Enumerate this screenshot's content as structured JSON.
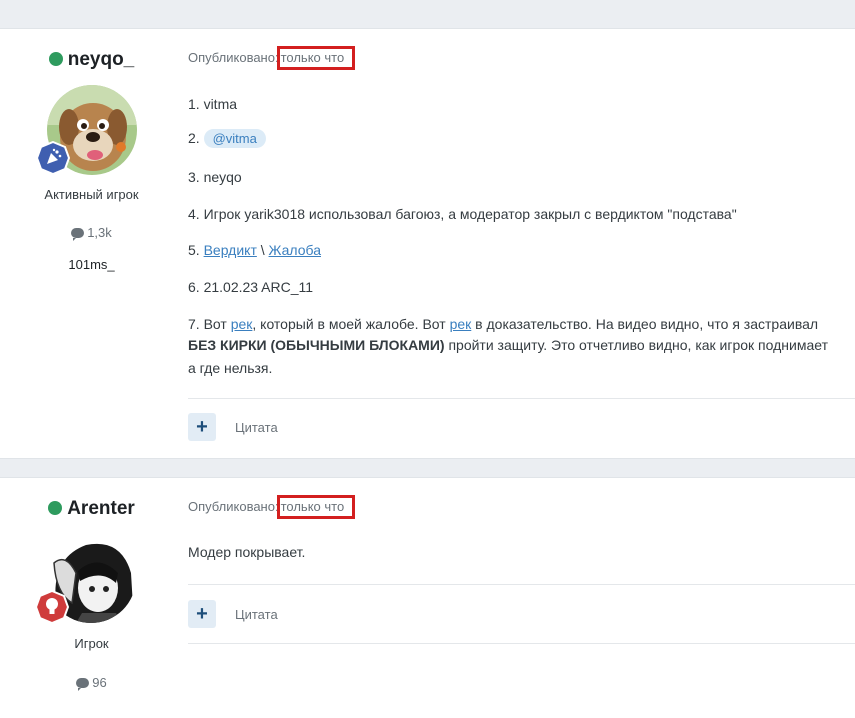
{
  "posts": [
    {
      "author": "neyqo_",
      "rank": "Активный игрок",
      "post_count": "1,3k",
      "signature": "101ms_",
      "published_label": "Опубликовано:",
      "published_time": "только что",
      "lines": {
        "l1": "1. vitma",
        "l2_prefix": "2.",
        "l2_mention": "@vitma",
        "l3": "3. neyqo",
        "l4": "4. Игрок yarik3018 использовал багоюз, а модератор закрыл с вердиктом \"подстава\"",
        "l5_prefix": "5.",
        "l5_link1": "Вердикт",
        "l5_sep": "\\",
        "l5_link2": "Жалоба",
        "l6": "6. 21.02.23 ARC_11",
        "l7_a": "7. Вот",
        "l7_link1": "рек",
        "l7_b": ", который в моей жалобе. Вот",
        "l7_link2": "рек",
        "l7_c": "в доказательство. На видео видно, что я застраивал",
        "l8_bold": "БЕЗ КИРКИ (ОБЫЧНЫМИ БЛОКАМИ)",
        "l8_rest": "пройти защиту. Это отчетливо видно, как игрок поднимает",
        "l9": "а где нельзя."
      },
      "quote_label": "Цитата"
    },
    {
      "author": "Arenter",
      "rank": "Игрок",
      "post_count": "96",
      "published_label": "Опубликовано:",
      "published_time": "только что",
      "text": "Модер покрывает.",
      "quote_label": "Цитата"
    }
  ],
  "icons": {
    "plus": "+",
    "status_online_color": "#2e9b5e",
    "highlight_color": "#d31f1f"
  }
}
